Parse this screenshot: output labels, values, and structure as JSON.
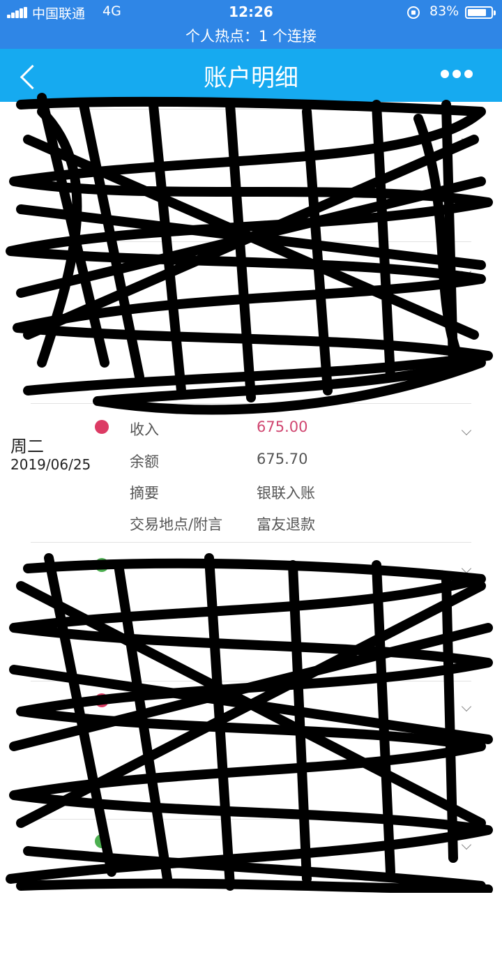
{
  "status_bar": {
    "carrier": "中国联通",
    "network": "4G",
    "time": "12:26",
    "battery": "83%",
    "hotspot": "个人热点：1 个连接"
  },
  "nav": {
    "title": "账户明细",
    "icons": {
      "back": "back-chevron-icon",
      "more": "more-dots-icon"
    }
  },
  "colors": {
    "income_dot": "#dc3b64",
    "expense_dot": "#4caf50",
    "nav_bg": "#16aaf0",
    "status_bg": "#2f86e6",
    "income_amount": "#d04670"
  },
  "transaction": {
    "weekday": "周二",
    "date": "2019/06/25",
    "type_label": "收入",
    "amount": "675.00",
    "balance_label": "余额",
    "balance": "675.70",
    "summary_label": "摘要",
    "summary": "银联入账",
    "location_label": "交易地点/附言",
    "location": "富友退款"
  }
}
